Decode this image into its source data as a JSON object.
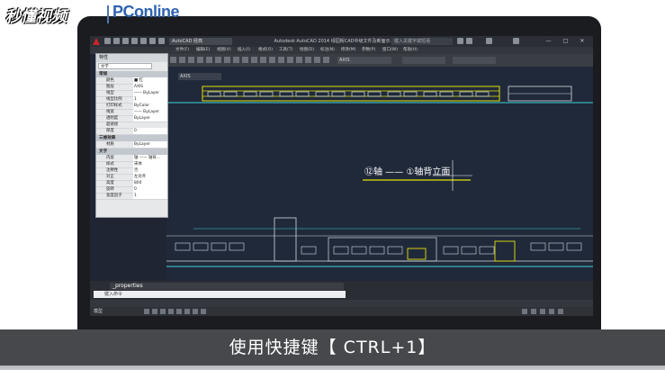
{
  "branding": {
    "logo_left": "秒懂视频",
    "logo_right": "PConline",
    "brand_blue": "#2f63b0"
  },
  "titlebar": {
    "workspace": "AutoCAD 经典",
    "title": "Autodesk AutoCAD 2014  绿园街CAD中级文件及断面示.dwg",
    "search_placeholder": "键入关键字或短语",
    "window_controls": [
      "—",
      "□",
      "✕"
    ]
  },
  "menubar": {
    "items": [
      "文件(F)",
      "编辑(E)",
      "视图(V)",
      "插入(I)",
      "格式(O)",
      "工具(T)",
      "绘图(D)",
      "标注(N)",
      "修改(M)",
      "参数(P)",
      "窗口(W)",
      "帮助(H)"
    ]
  },
  "ribbon": {
    "layer_value": "AXIS",
    "bylayer_1": "ByLayer",
    "bylayer_2": "ByLayer"
  },
  "properties": {
    "caption": "特性",
    "selection": "文字",
    "sections": [
      {
        "title": "常规",
        "rows": [
          {
            "key": "颜色",
            "value": "■ 红"
          },
          {
            "key": "图层",
            "value": "AXIS"
          },
          {
            "key": "线型",
            "value": "—— ByLayer"
          },
          {
            "key": "线型比例",
            "value": "1"
          },
          {
            "key": "打印样式",
            "value": "ByColor"
          },
          {
            "key": "线宽",
            "value": "—— ByLayer"
          },
          {
            "key": "透明度",
            "value": "ByLayer"
          },
          {
            "key": "超链接",
            "value": ""
          },
          {
            "key": "厚度",
            "value": "0"
          }
        ]
      },
      {
        "title": "三维效果",
        "rows": [
          {
            "key": "材质",
            "value": "ByLayer"
          }
        ]
      },
      {
        "title": "文字",
        "rows": [
          {
            "key": "内容",
            "value": "轴 —— 轴背..."
          },
          {
            "key": "样式",
            "value": "宋体"
          },
          {
            "key": "注释性",
            "value": "否"
          },
          {
            "key": "对正",
            "value": "左对齐"
          },
          {
            "key": "高度",
            "value": "800"
          },
          {
            "key": "旋转",
            "value": "0"
          },
          {
            "key": "宽度因子",
            "value": "1"
          }
        ]
      }
    ]
  },
  "drawing": {
    "file_tab": "AXIS",
    "elevation_title": "⑫轴 —— ①轴背立面",
    "background": "#20293a",
    "accent_yellow": "#e4e10a",
    "accent_cyan": "#3cd3d8"
  },
  "command": {
    "history": "_properties",
    "input_placeholder": "键入命令"
  },
  "statusbar": {
    "model": "模型"
  },
  "subtitle": "使用快捷键【 CTRL+1】"
}
